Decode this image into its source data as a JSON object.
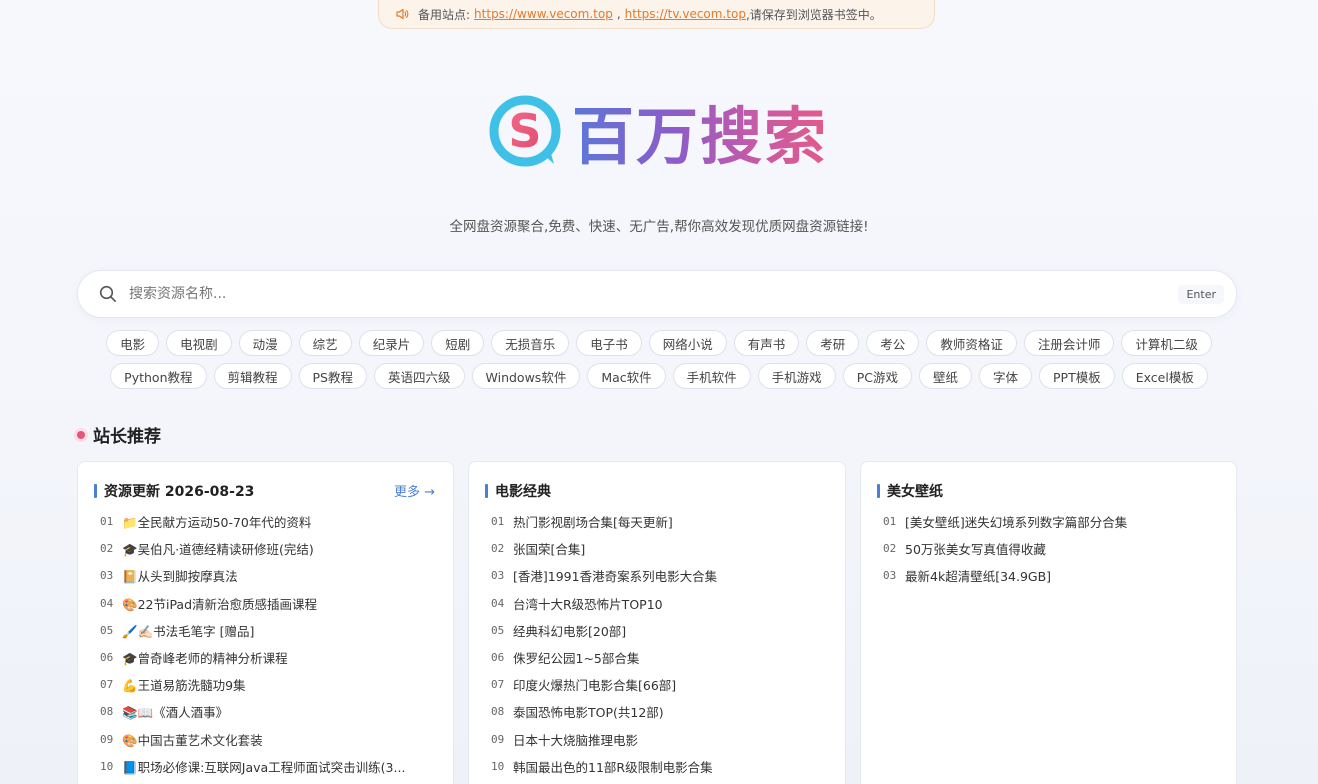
{
  "notice": {
    "icon": "speaker-icon",
    "prefix": "备用站点:",
    "link1": "https://www.vecom.top",
    "sep": ",",
    "link2": "https://tv.vecom.top",
    "suffix": ",请保存到浏览器书签中。"
  },
  "brand": {
    "name": "百万搜索",
    "logo_letter": "S"
  },
  "tagline": "全网盘资源聚合,免费、快速、无广告,帮你高效发现优质网盘资源链接!",
  "search": {
    "placeholder": "搜索资源名称...",
    "enter": "Enter"
  },
  "tags_row1": [
    "电影",
    "电视剧",
    "动漫",
    "综艺",
    "纪录片",
    "短剧",
    "无损音乐",
    "电子书",
    "网络小说",
    "有声书",
    "考研",
    "考公",
    "教师资格证",
    "注册会计师",
    "计算机二级"
  ],
  "tags_row2": [
    "Python教程",
    "剪辑教程",
    "PS教程",
    "英语四六级",
    "Windows软件",
    "Mac软件",
    "手机软件",
    "手机游戏",
    "PC游戏",
    "壁纸",
    "字体",
    "PPT模板",
    "Excel模板"
  ],
  "section_title": "站长推荐",
  "cards": [
    {
      "title": "资源更新 2026-08-23",
      "more": "更多 →",
      "items": [
        {
          "num": "01",
          "text": "📁全民献方运动50-70年代的资料"
        },
        {
          "num": "02",
          "text": "🎓吴伯凡·道德经精读研修班(完结)"
        },
        {
          "num": "03",
          "text": "📔从头到脚按摩真法"
        },
        {
          "num": "04",
          "text": "🎨22节iPad清新治愈质感插画课程"
        },
        {
          "num": "05",
          "text": "🖌️✍🏻书法毛笔字 [赠品]"
        },
        {
          "num": "06",
          "text": "🎓曾奇峰老师的精神分析课程"
        },
        {
          "num": "07",
          "text": "💪王道易筋洗髓功9集"
        },
        {
          "num": "08",
          "text": "📚📖《酒人酒事》"
        },
        {
          "num": "09",
          "text": "🎨中国古董艺术文化套装"
        },
        {
          "num": "10",
          "text": "📘职场必修课:互联网Java工程师面试突击训练(3..."
        }
      ]
    },
    {
      "title": "电影经典",
      "items": [
        {
          "num": "01",
          "text": "热门影视剧场合集[每天更新]"
        },
        {
          "num": "02",
          "text": "张国荣[合集]"
        },
        {
          "num": "03",
          "text": "[香港]1991香港奇案系列电影大合集"
        },
        {
          "num": "04",
          "text": "台湾十大R级恐怖片TOP10"
        },
        {
          "num": "05",
          "text": "经典科幻电影[20部]"
        },
        {
          "num": "06",
          "text": "侏罗纪公园1~5部合集"
        },
        {
          "num": "07",
          "text": "印度火爆热门电影合集[66部]"
        },
        {
          "num": "08",
          "text": "泰国恐怖电影TOP(共12部)"
        },
        {
          "num": "09",
          "text": "日本十大烧脑推理电影"
        },
        {
          "num": "10",
          "text": "韩国最出色的11部R级限制电影合集"
        }
      ]
    },
    {
      "title": "美女壁纸",
      "items": [
        {
          "num": "01",
          "text": "[美女壁纸]迷失幻境系列数字篇部分合集"
        },
        {
          "num": "02",
          "text": "50万张美女写真值得收藏"
        },
        {
          "num": "03",
          "text": "最新4k超清壁纸[34.9GB]"
        }
      ]
    }
  ]
}
